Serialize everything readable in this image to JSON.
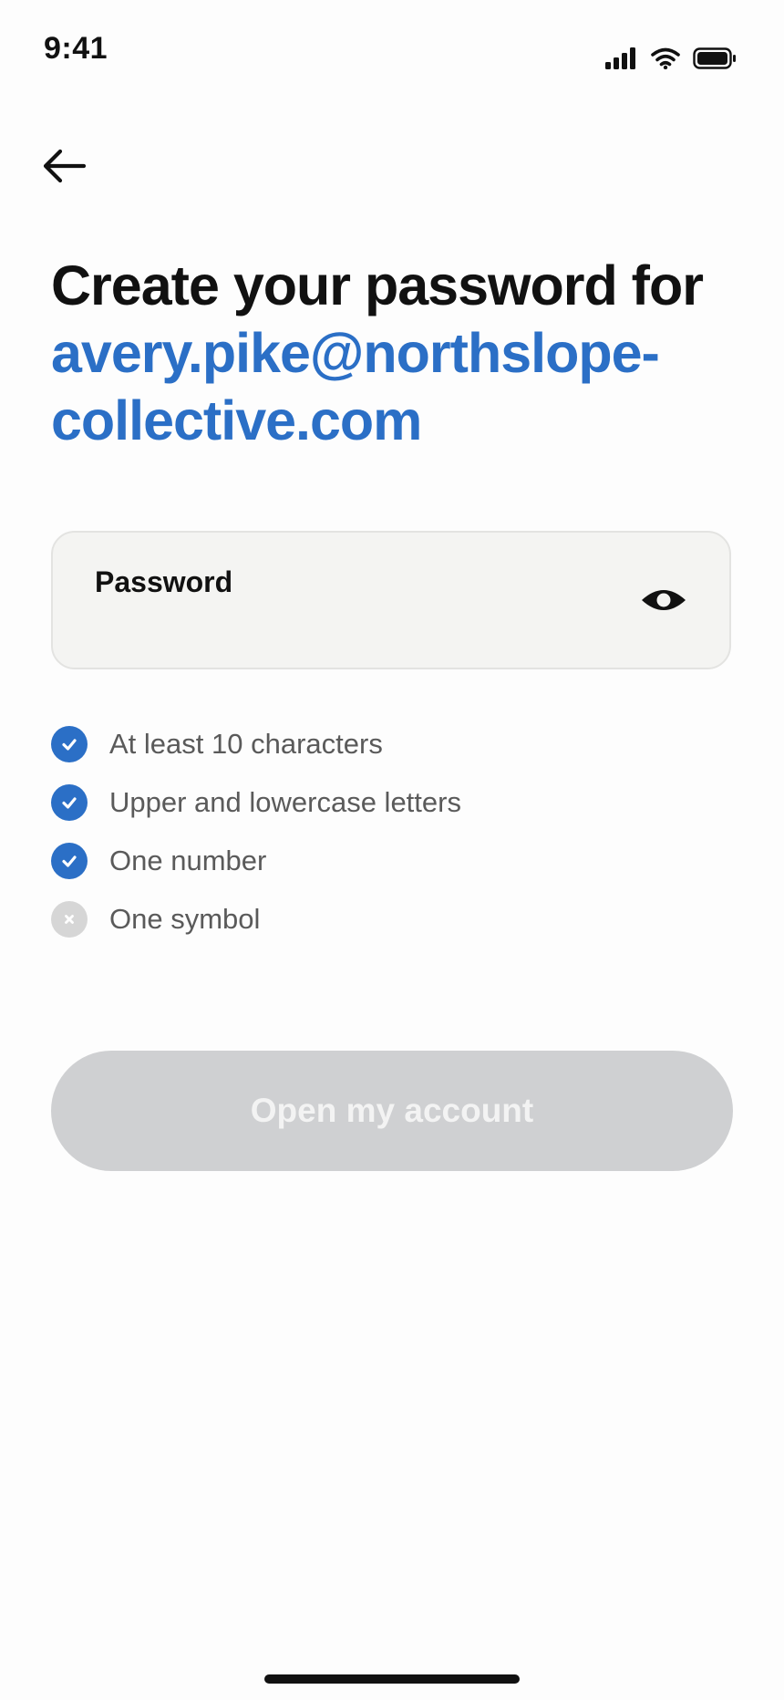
{
  "status_bar": {
    "time": "9:41",
    "icons": [
      "cellular-signal-icon",
      "wifi-icon",
      "battery-icon"
    ]
  },
  "nav": {
    "back_icon": "arrow-left-icon"
  },
  "headline": {
    "title": "Create your password for",
    "email_line_1": "avery.pike@northslope-",
    "email_line_2": "collective.com"
  },
  "password_field": {
    "label": "Password",
    "value": "",
    "toggle_icon": "eye-icon"
  },
  "requirements": [
    {
      "label": "At least 10 characters",
      "met": true
    },
    {
      "label": "Upper and lowercase letters",
      "met": true
    },
    {
      "label": "One number",
      "met": true
    },
    {
      "label": "One symbol",
      "met": false
    }
  ],
  "primary_button": {
    "label": "Open my account",
    "enabled": false
  },
  "colors": {
    "accent": "#2b6fc6",
    "text": "#111111",
    "muted_text": "#5a5a5a",
    "field_bg": "#f4f4f2",
    "disabled_button": "#cfd0d2",
    "unmet_badge": "#d6d6d6"
  }
}
